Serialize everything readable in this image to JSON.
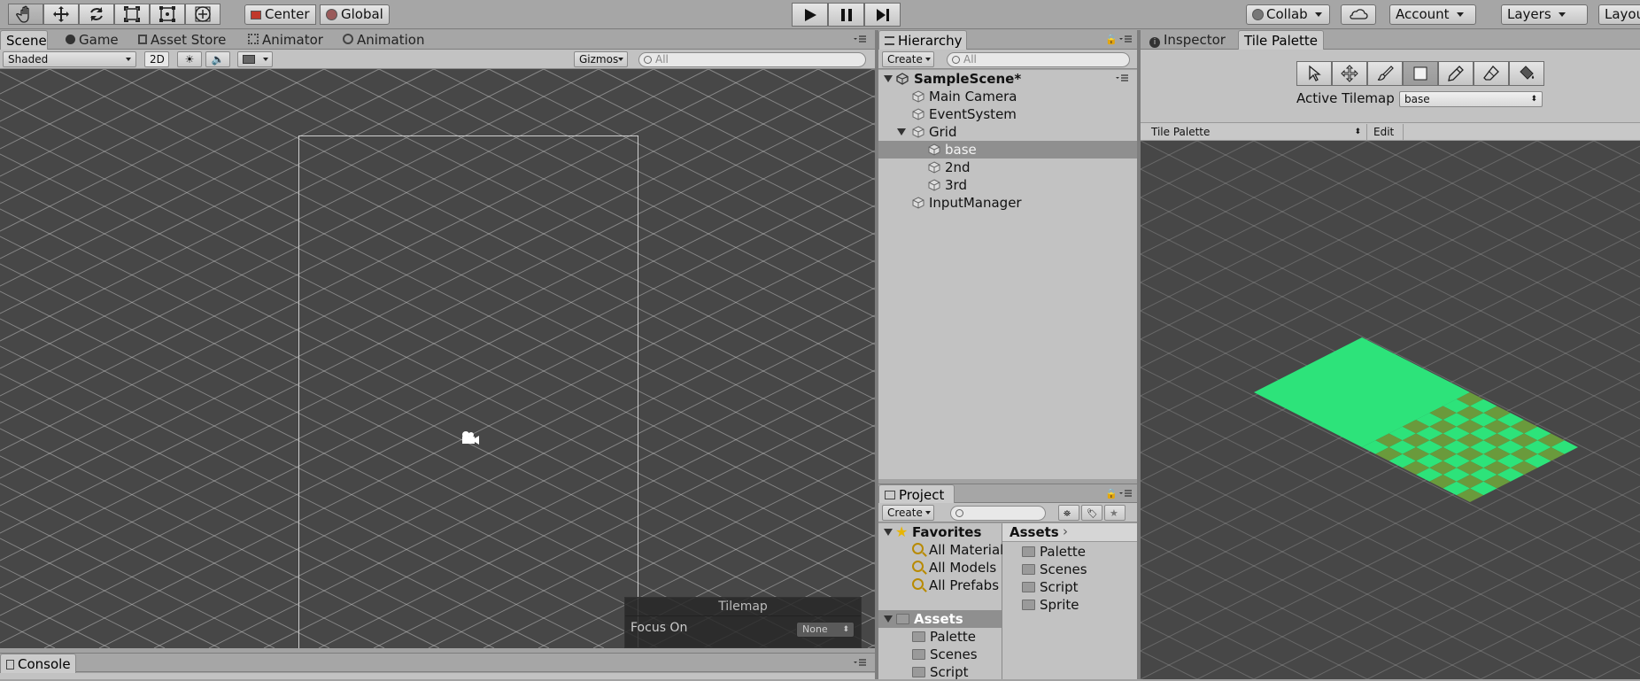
{
  "toolbar": {
    "pivot_label": "Center",
    "space_label": "Global",
    "collab_label": "Collab",
    "account_label": "Account",
    "layers_label": "Layers",
    "layout_label": "Layout"
  },
  "scene_panel": {
    "tabs": [
      "Scene",
      "Game",
      "Asset Store",
      "Animator",
      "Animation"
    ],
    "shading_mode": "Shaded",
    "mode_2d_label": "2D",
    "gizmos_label": "Gizmos",
    "search_placeholder": "All",
    "tilemap_overlay": {
      "title": "Tilemap",
      "focus_label": "Focus On",
      "focus_value": "None"
    }
  },
  "hierarchy": {
    "tab_label": "Hierarchy",
    "create_label": "Create",
    "search_placeholder": "All",
    "scene_name": "SampleScene*",
    "items": [
      "Main Camera",
      "EventSystem",
      "Grid",
      "base",
      "2nd",
      "3rd",
      "InputManager"
    ],
    "selected": "base"
  },
  "project": {
    "tab_label": "Project",
    "create_label": "Create",
    "favorites_label": "Favorites",
    "favorites": [
      "All Materials",
      "All Models",
      "All Prefabs"
    ],
    "assets_label": "Assets",
    "asset_folders": [
      "Palette",
      "Scenes",
      "Script"
    ],
    "breadcrumb": "Assets",
    "content_folders": [
      "Palette",
      "Scenes",
      "Script",
      "Sprite"
    ]
  },
  "right_panel": {
    "tabs": [
      "Inspector",
      "Tile Palette"
    ],
    "active_tilemap_label": "Active Tilemap",
    "active_tilemap_value": "base",
    "palette_dropdown": "Tile Palette",
    "edit_label": "Edit"
  },
  "console": {
    "tab_label": "Console"
  },
  "colors": {
    "tile_green": "#2de37a",
    "tile_olive": "#6a9a3c",
    "scene_bg": "#474747",
    "editor_bg": "#a2a2a2"
  }
}
